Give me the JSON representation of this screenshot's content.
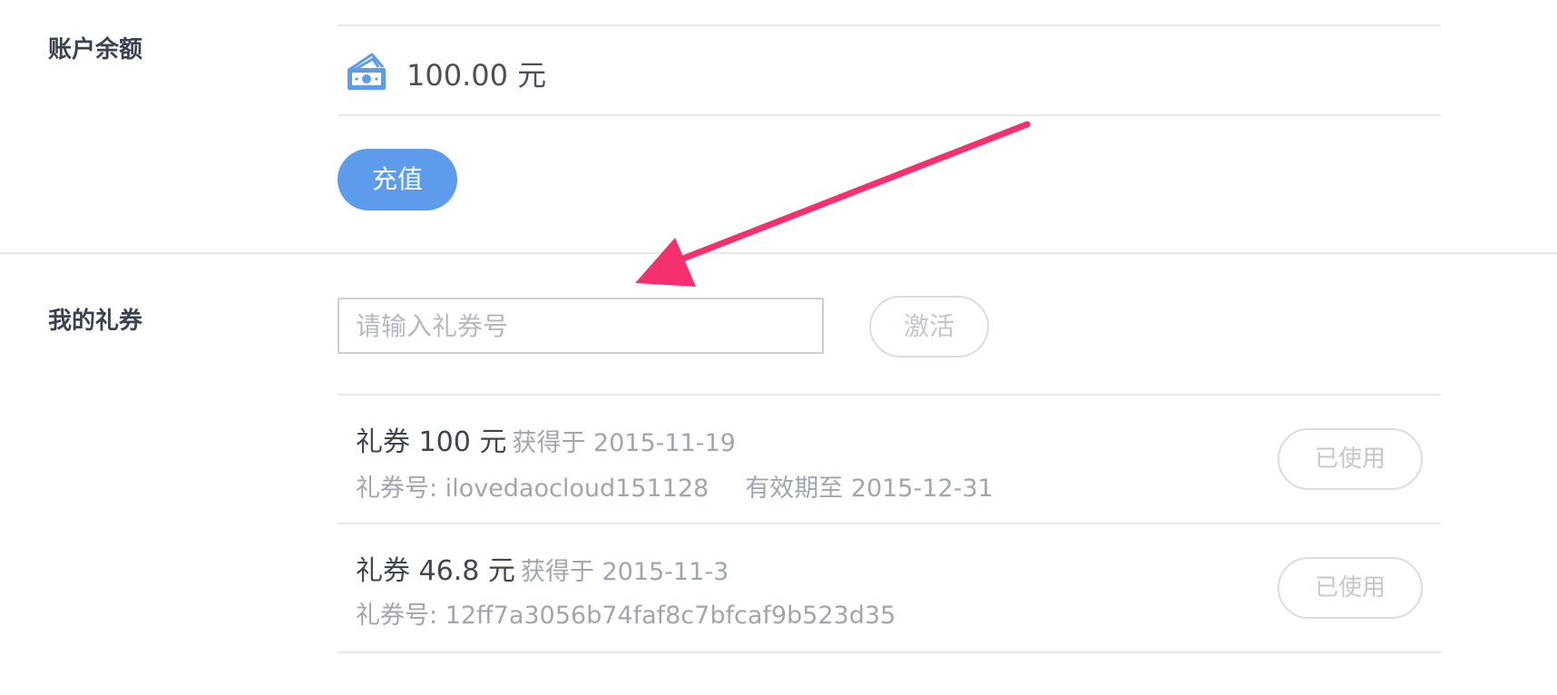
{
  "balance": {
    "label": "账户余额",
    "amount": "100.00 元",
    "recharge_label": "充值"
  },
  "coupons": {
    "label": "我的礼券",
    "input_placeholder": "请输入礼券号",
    "activate_label": "激活",
    "items": [
      {
        "title": "礼券 100 元",
        "obtained": "获得于 2015-11-19",
        "code": "礼券号: ilovedaocloud151128",
        "valid_until": "有效期至 2015-12-31",
        "status": "已使用"
      },
      {
        "title": "礼券 46.8 元",
        "obtained": "获得于 2015-11-3",
        "code": "礼券号: 12ff7a3056b74faf8c7bfcaf9b523d35",
        "status": "已使用"
      }
    ]
  },
  "colors": {
    "primary": "#5c9ceb",
    "annotation_arrow": "#f5306f"
  }
}
